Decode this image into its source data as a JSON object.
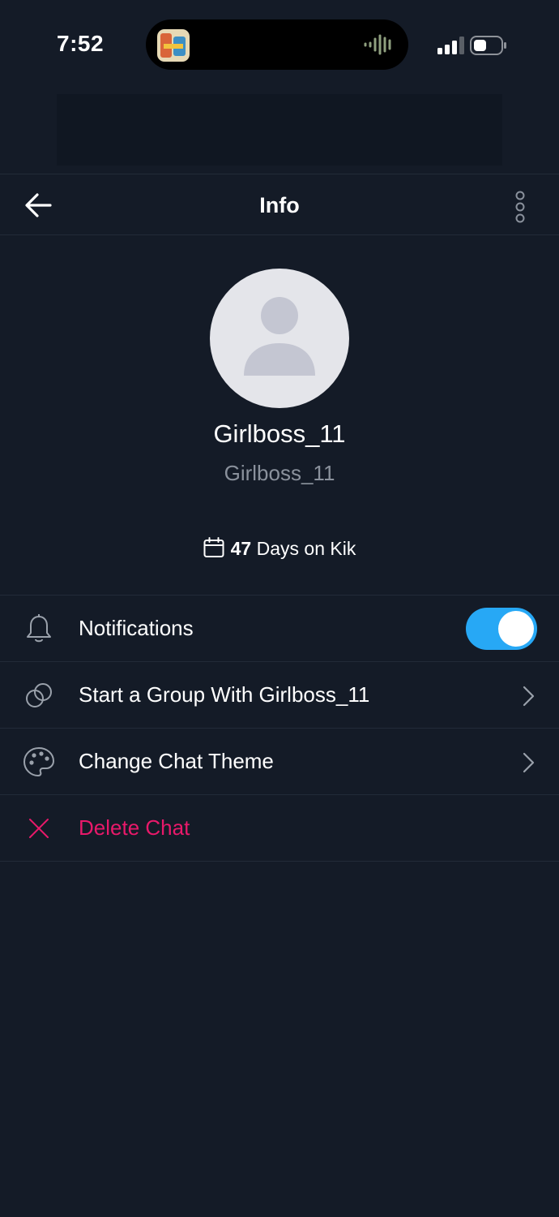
{
  "status_bar": {
    "time": "7:52"
  },
  "header": {
    "title": "Info"
  },
  "profile": {
    "display_name": "Girlboss_11",
    "username": "Girlboss_11",
    "days_count": "47",
    "days_suffix": "Days on Kik"
  },
  "settings": {
    "notifications_label": "Notifications",
    "notifications_enabled": true,
    "start_group_label": "Start a Group With Girlboss_11",
    "change_theme_label": "Change Chat Theme",
    "delete_chat_label": "Delete Chat"
  },
  "colors": {
    "background": "#141b27",
    "accent": "#27a8f5",
    "danger": "#e8196a",
    "muted_text": "#8a919c"
  },
  "icons": [
    "back-arrow-icon",
    "more-vertical-icon",
    "calendar-icon",
    "bell-icon",
    "group-circles-icon",
    "palette-icon",
    "close-icon",
    "chevron-right-icon"
  ]
}
